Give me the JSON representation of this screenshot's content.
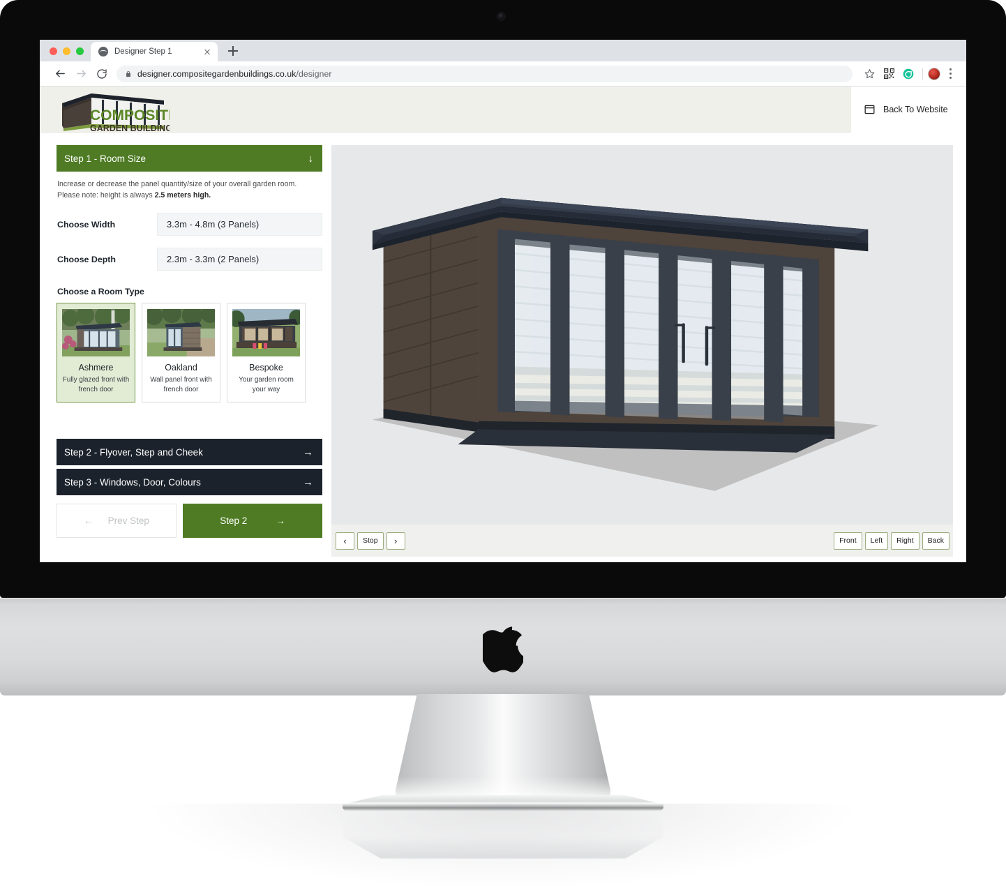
{
  "browser": {
    "tab": {
      "title": "Designer Step 1",
      "favicon": "globe-icon",
      "close": "×"
    },
    "new_tab_label": "+",
    "url_host": "designer.compositegardenbuildings.co.uk",
    "url_path": "/designer",
    "nav": {
      "back": "←",
      "forward": "→",
      "reload": "⟳"
    },
    "toolbar_icons": [
      "star-icon",
      "qr-code-icon",
      "grammarly-icon",
      "avatar-icon",
      "kebab-menu-icon"
    ]
  },
  "site": {
    "logo_primary": "COMPOSITE",
    "logo_secondary": "GARDEN BUILDINGS",
    "back_to_website": "Back To Website"
  },
  "designer": {
    "step1": {
      "title": "Step 1 - Room Size",
      "arrow": "↓",
      "desc_line1": "Increase or decrease the panel quantity/size of your overall garden room.",
      "desc_line2_prefix": "Please note: height is always ",
      "desc_line2_bold": "2.5 meters high.",
      "width_label": "Choose Width",
      "width_value": "3.3m - 4.8m (3 Panels)",
      "depth_label": "Choose Depth",
      "depth_value": "2.3m - 3.3m (2 Panels)",
      "room_type_label": "Choose a Room Type",
      "room_types": [
        {
          "name": "Ashmere",
          "desc": "Fully glazed front with french door",
          "selected": true
        },
        {
          "name": "Oakland",
          "desc": "Wall panel front with french door",
          "selected": false
        },
        {
          "name": "Bespoke",
          "desc": "Your garden room your way",
          "selected": false
        }
      ]
    },
    "step2": {
      "title": "Step 2 - Flyover, Step and Cheek",
      "arrow": "→"
    },
    "step3": {
      "title": "Step 3 - Windows, Door, Colours",
      "arrow": "→"
    },
    "nav": {
      "prev_label": "Prev Step",
      "prev_arrow": "←",
      "next_label": "Step 2",
      "next_arrow": "→"
    }
  },
  "viewer": {
    "rotate_left": "‹",
    "stop": "Stop",
    "rotate_right": "›",
    "views": [
      "Front",
      "Left",
      "Right",
      "Back"
    ]
  },
  "colors": {
    "brand_green": "#4e7b23",
    "logo_green": "#5c8727",
    "dark_navy": "#1c222c",
    "selected_card_bg": "#e2ecd5",
    "selected_card_border": "#6f9440",
    "viewer_bg": "#e7e8e9",
    "header_bg": "#f0f0ea"
  }
}
